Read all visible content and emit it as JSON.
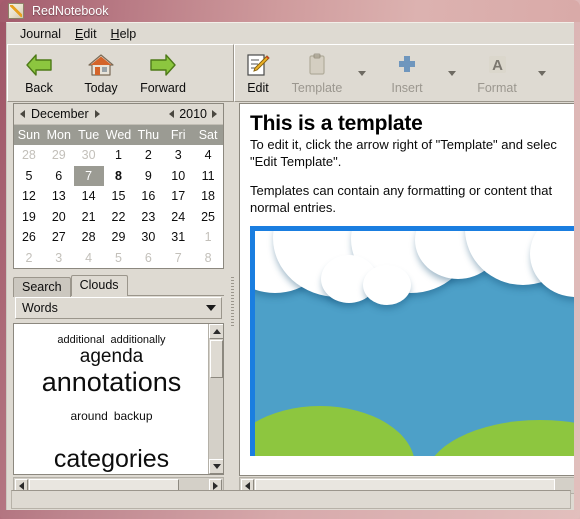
{
  "window": {
    "title": "RedNotebook",
    "icon": "notebook-pencil-icon"
  },
  "menu": {
    "items": [
      {
        "label": "Journal",
        "mnemonic": ""
      },
      {
        "label": "Edit",
        "mnemonic": "E"
      },
      {
        "label": "Help",
        "mnemonic": "H"
      }
    ]
  },
  "toolbar_left": {
    "buttons": [
      {
        "label": "Back",
        "icon": "arrow-left-green-icon",
        "enabled": true
      },
      {
        "label": "Today",
        "icon": "home-icon",
        "enabled": true
      },
      {
        "label": "Forward",
        "icon": "arrow-right-green-icon",
        "enabled": true
      }
    ]
  },
  "toolbar_right": {
    "buttons": [
      {
        "label": "Edit",
        "icon": "edit-pencil-icon",
        "enabled": true,
        "has_arrow": false
      },
      {
        "label": "Template",
        "icon": "clipboard-icon",
        "enabled": false,
        "has_arrow": true
      },
      {
        "label": "Insert",
        "icon": "plus-icon",
        "enabled": false,
        "has_arrow": true
      },
      {
        "label": "Format",
        "icon": "letter-a-icon",
        "enabled": false,
        "has_arrow": true
      }
    ]
  },
  "calendar": {
    "month": "December",
    "year": "2010",
    "prev_month_icon": "triangle-left-icon",
    "next_month_icon": "triangle-right-icon",
    "prev_year_icon": "triangle-left-icon",
    "next_year_icon": "triangle-right-icon",
    "weekdays": [
      "Sun",
      "Mon",
      "Tue",
      "Wed",
      "Thu",
      "Fri",
      "Sat"
    ],
    "selected_day": 7,
    "bold_days": [
      8
    ],
    "weeks": [
      [
        {
          "d": "28",
          "o": true
        },
        {
          "d": "29",
          "o": true
        },
        {
          "d": "30",
          "o": true
        },
        {
          "d": "1"
        },
        {
          "d": "2"
        },
        {
          "d": "3"
        },
        {
          "d": "4"
        }
      ],
      [
        {
          "d": "5"
        },
        {
          "d": "6"
        },
        {
          "d": "7",
          "sel": true
        },
        {
          "d": "8",
          "bold": true
        },
        {
          "d": "9"
        },
        {
          "d": "10"
        },
        {
          "d": "11"
        }
      ],
      [
        {
          "d": "12"
        },
        {
          "d": "13"
        },
        {
          "d": "14"
        },
        {
          "d": "15"
        },
        {
          "d": "16"
        },
        {
          "d": "17"
        },
        {
          "d": "18"
        }
      ],
      [
        {
          "d": "19"
        },
        {
          "d": "20"
        },
        {
          "d": "21"
        },
        {
          "d": "22"
        },
        {
          "d": "23"
        },
        {
          "d": "24"
        },
        {
          "d": "25"
        }
      ],
      [
        {
          "d": "26"
        },
        {
          "d": "27"
        },
        {
          "d": "28"
        },
        {
          "d": "29"
        },
        {
          "d": "30"
        },
        {
          "d": "31"
        },
        {
          "d": "1",
          "o": true
        }
      ],
      [
        {
          "d": "2",
          "o": true
        },
        {
          "d": "3",
          "o": true
        },
        {
          "d": "4",
          "o": true
        },
        {
          "d": "5",
          "o": true
        },
        {
          "d": "6",
          "o": true
        },
        {
          "d": "7",
          "o": true
        },
        {
          "d": "8",
          "o": true
        }
      ]
    ]
  },
  "sidebar_tabs": {
    "items": [
      {
        "label": "Search",
        "active": false
      },
      {
        "label": "Clouds",
        "active": true
      }
    ]
  },
  "cloud_selector": {
    "value": "Words",
    "arrow_icon": "chevron-down-icon"
  },
  "word_cloud": {
    "words": [
      {
        "text": "additional",
        "size": 11
      },
      {
        "text": "additionally",
        "size": 11
      },
      {
        "text": "agenda",
        "size": 19
      },
      {
        "text": "annotations",
        "size": 27
      },
      {
        "text": "around",
        "size": 12
      },
      {
        "text": "backup",
        "size": 12
      },
      {
        "text": "categories",
        "size": 25
      }
    ]
  },
  "document": {
    "title": "This is a template",
    "paragraphs": [
      "To edit it, click the arrow right of \"Template\" and selec",
      "\"Edit Template\"."
    ],
    "paragraphs2": [
      "Templates can contain any formatting or content that",
      "normal entries."
    ],
    "image_alt": "sky-clouds-hills-illustration",
    "image_colors": {
      "sky": "#4da0c8",
      "cloud": "#ffffff",
      "hill": "#8dc63f",
      "border": "#1a7ee0"
    }
  },
  "statusbar": {
    "text": ""
  },
  "scrollbars": {
    "cloud_up_icon": "triangle-up-icon",
    "cloud_down_icon": "triangle-down-icon",
    "left_icon": "triangle-left-icon",
    "right_icon": "triangle-right-icon"
  },
  "colors": {
    "titlebar_start": "#a25b6c",
    "titlebar_end": "#dcb2b0",
    "chrome": "#dedad2",
    "calendar_header_bg": "#9b9b93",
    "selection": "#9b9b93"
  }
}
